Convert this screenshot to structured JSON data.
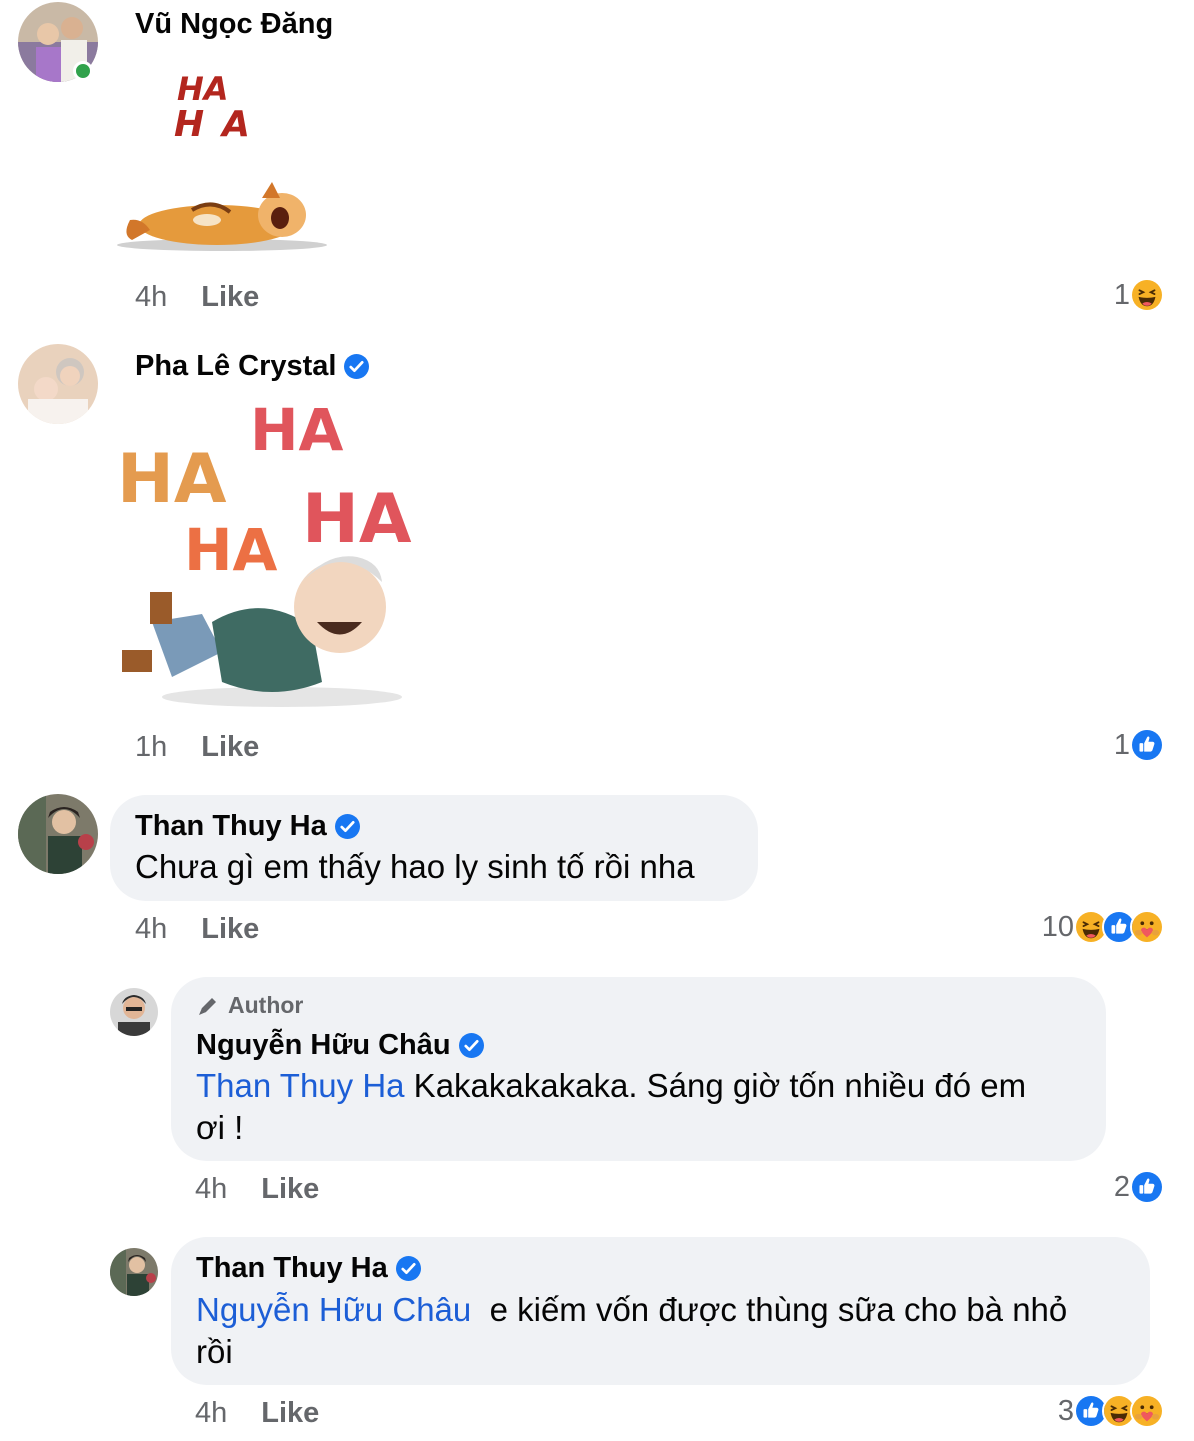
{
  "comments": [
    {
      "name": "Vũ Ngọc Đăng",
      "online": true,
      "sticker_text": [
        "HA",
        "HA"
      ],
      "time": "4h",
      "like_label": "Like",
      "reaction_count": "1",
      "reactions": [
        "haha"
      ]
    },
    {
      "name": "Pha Lê Crystal",
      "verified": true,
      "sticker_text": [
        "HA",
        "HA",
        "HA",
        "HA"
      ],
      "time": "1h",
      "like_label": "Like",
      "reaction_count": "1",
      "reactions": [
        "like"
      ]
    },
    {
      "name": "Than Thuy Ha",
      "verified": true,
      "text": "Chưa gì em thấy hao ly sinh tố rồi nha",
      "time": "4h",
      "like_label": "Like",
      "reaction_count": "10",
      "reactions": [
        "haha",
        "like",
        "care"
      ]
    }
  ],
  "replies": [
    {
      "badge": "Author",
      "name": "Nguyễn Hữu Châu",
      "verified": true,
      "mention": "Than Thuy Ha",
      "text_line1": " Kakakakakaka. Sáng giờ tốn nhiều đó em",
      "text_line2": "ơi !",
      "time": "4h",
      "like_label": "Like",
      "reaction_count": "2",
      "reactions": [
        "like"
      ]
    },
    {
      "name": "Than Thuy Ha",
      "verified": true,
      "mention": "Nguyễn Hữu Châu",
      "text_line1": "  e kiếm vốn được thùng sữa cho bà nhỏ",
      "text_line2": "rồi",
      "time": "4h",
      "like_label": "Like",
      "reaction_count": "3",
      "reactions": [
        "like",
        "haha",
        "care"
      ]
    }
  ],
  "colors": {
    "verified": "#1877f2",
    "like": "#1877f2",
    "haha": "#f7b125",
    "mention": "#1c5ed6",
    "online": "#31a24c"
  }
}
